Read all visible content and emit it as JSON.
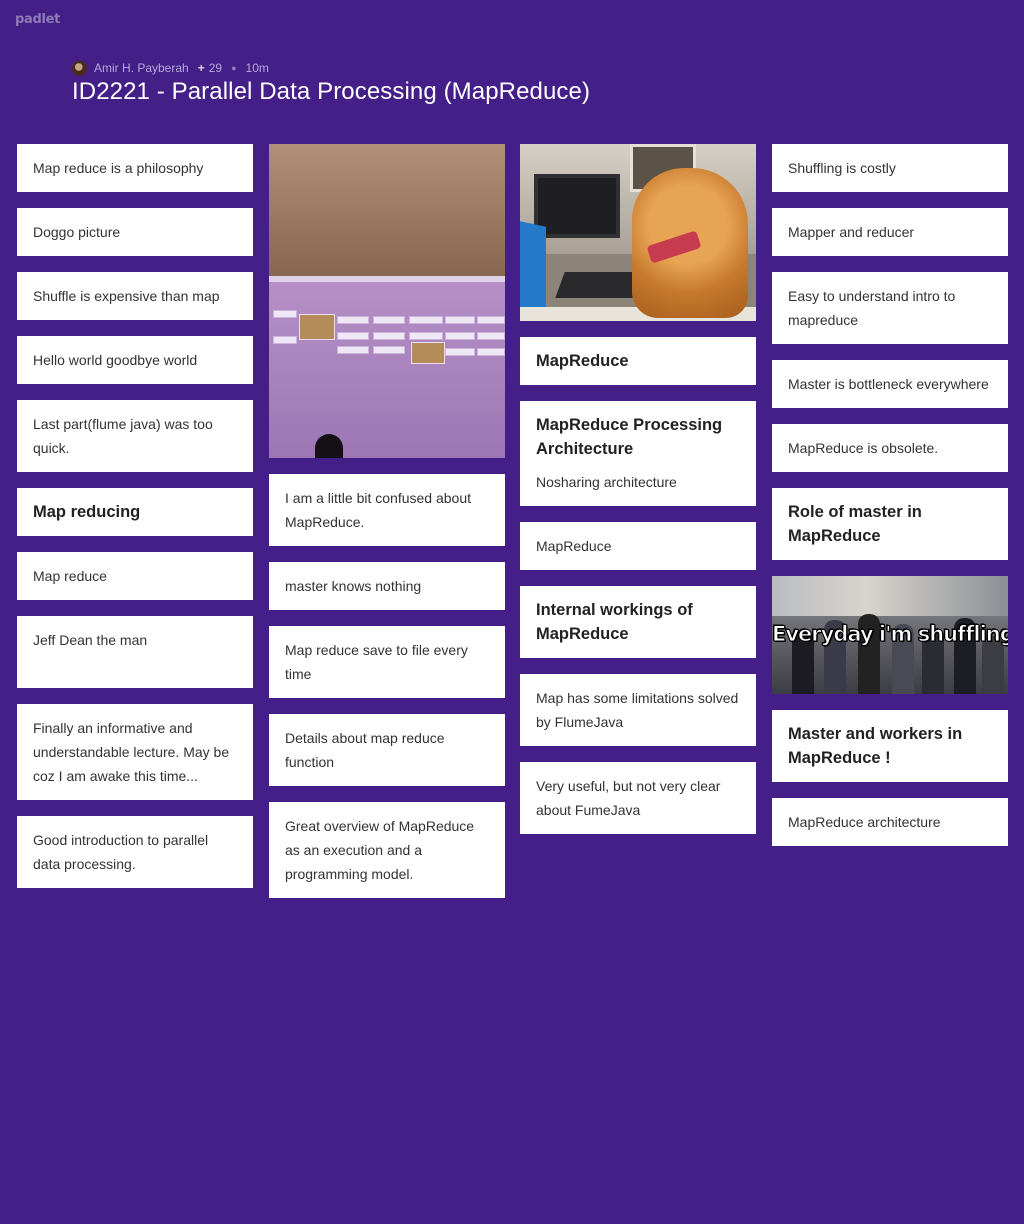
{
  "app": {
    "logo": "padlet"
  },
  "header": {
    "author": "Amir H. Payberah",
    "likes": "29",
    "time": "10m",
    "title": "ID2221 - Parallel Data Processing (MapReduce)"
  },
  "columns": {
    "c1": [
      "Map reduce is a philosophy",
      "Doggo picture",
      "Shuffle is expensive than map",
      "Hello world goodbye world",
      "Last part(flume java) was too quick.",
      "Map reducing",
      "Map reduce",
      "Jeff Dean the man",
      "Finally an informative and understandable lecture. May be coz I am awake this time...",
      "Good introduction to parallel data processing."
    ],
    "c2": [
      "I am a little bit confused about MapReduce.",
      "master knows nothing",
      "Map reduce save to file every time",
      "Details about map reduce function",
      "Great overview of MapReduce as an execution and a programming model."
    ],
    "c3": [
      "MapReduce",
      "MapReduce Processing Architecture",
      "Nosharing architecture",
      "MapReduce",
      "Internal workings of MapReduce",
      "Map has some limitations solved by FlumeJava",
      "Very useful, but not very clear about FumeJava"
    ],
    "c4": [
      "Shuffling is costly",
      "Mapper and reducer",
      "Easy to understand intro to mapreduce",
      "Master is bottleneck everywhere",
      "MapReduce is obsolete.",
      "Role of master in MapReduce",
      "Everyday i'm shuffling",
      "Master and workers in MapReduce !",
      "MapReduce architecture"
    ]
  },
  "icons": {
    "avatar": "user-avatar-icon",
    "like": "plus-icon"
  },
  "colors": {
    "background": "#431f87",
    "card": "#ffffff"
  }
}
